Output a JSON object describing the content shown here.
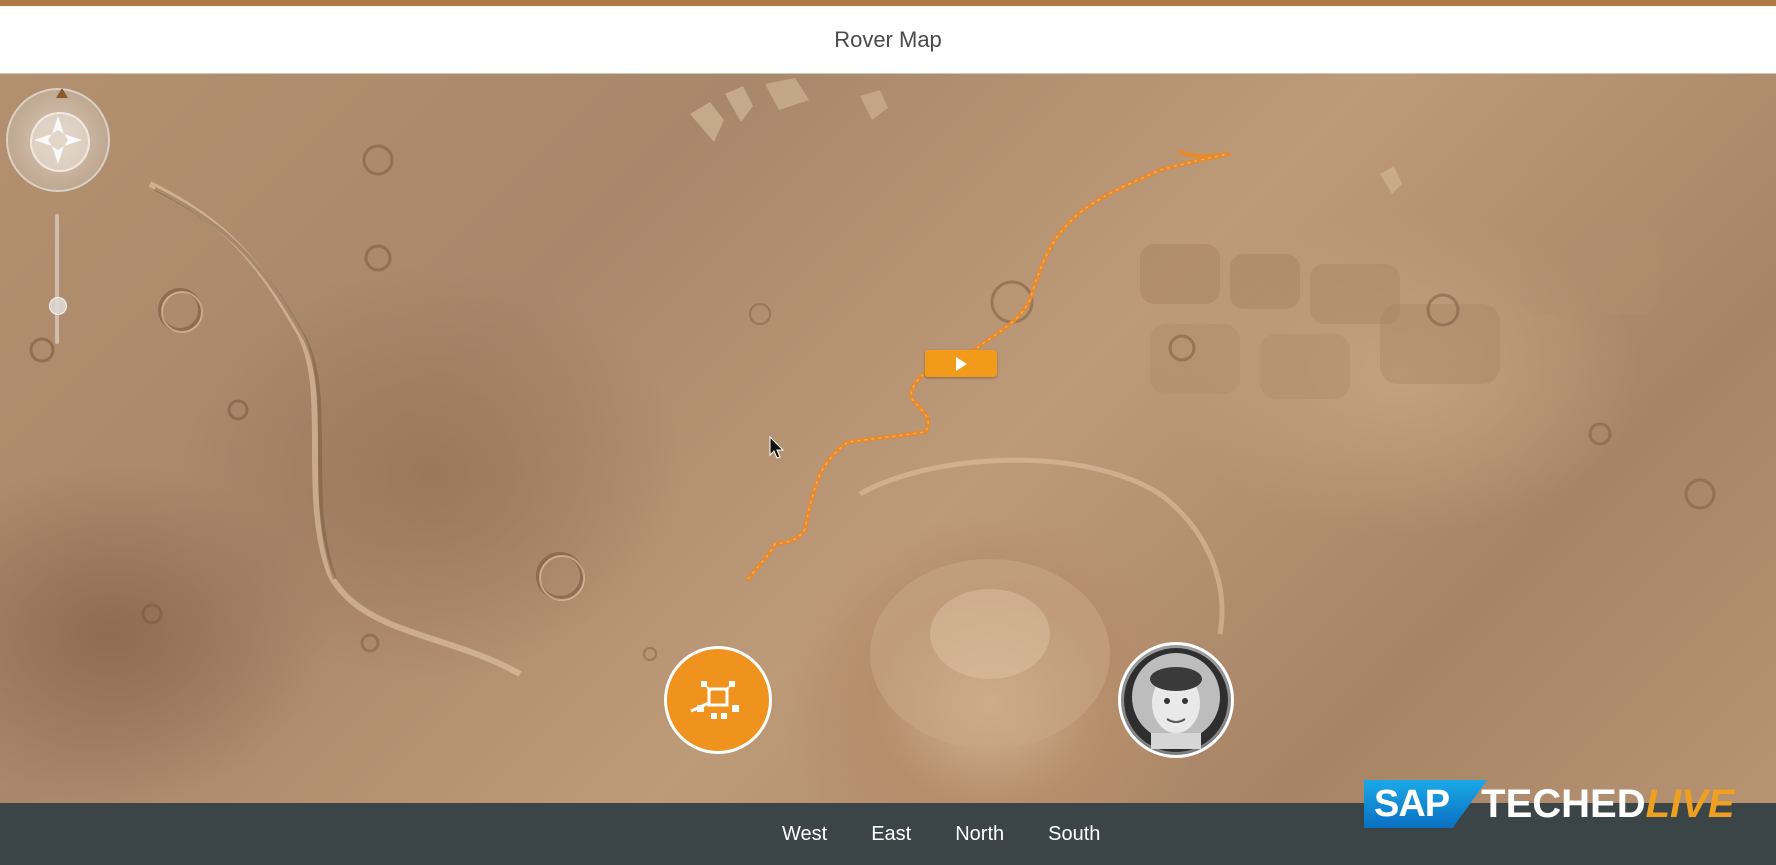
{
  "header": {
    "title": "Rover Map"
  },
  "map": {
    "controls": {
      "nav": "compass-pan-icon",
      "zoom": "zoom-slider"
    },
    "play_button": {
      "icon": "play-icon",
      "color": "#f29a1a"
    },
    "markers": {
      "rover": {
        "icon": "rover-icon",
        "color": "#ef931e"
      },
      "astronaut": {
        "icon": "astronaut-avatar"
      }
    },
    "route": {
      "color": "#e8892a"
    }
  },
  "footer": {
    "buttons": [
      "West",
      "East",
      "North",
      "South"
    ]
  },
  "brand": {
    "sap": "SAP",
    "teched": "TECHED",
    "live": "LIVE"
  },
  "colors": {
    "accent": "#b07a45",
    "footer_bg": "#3b4446",
    "brand_orange": "#f0a020"
  }
}
